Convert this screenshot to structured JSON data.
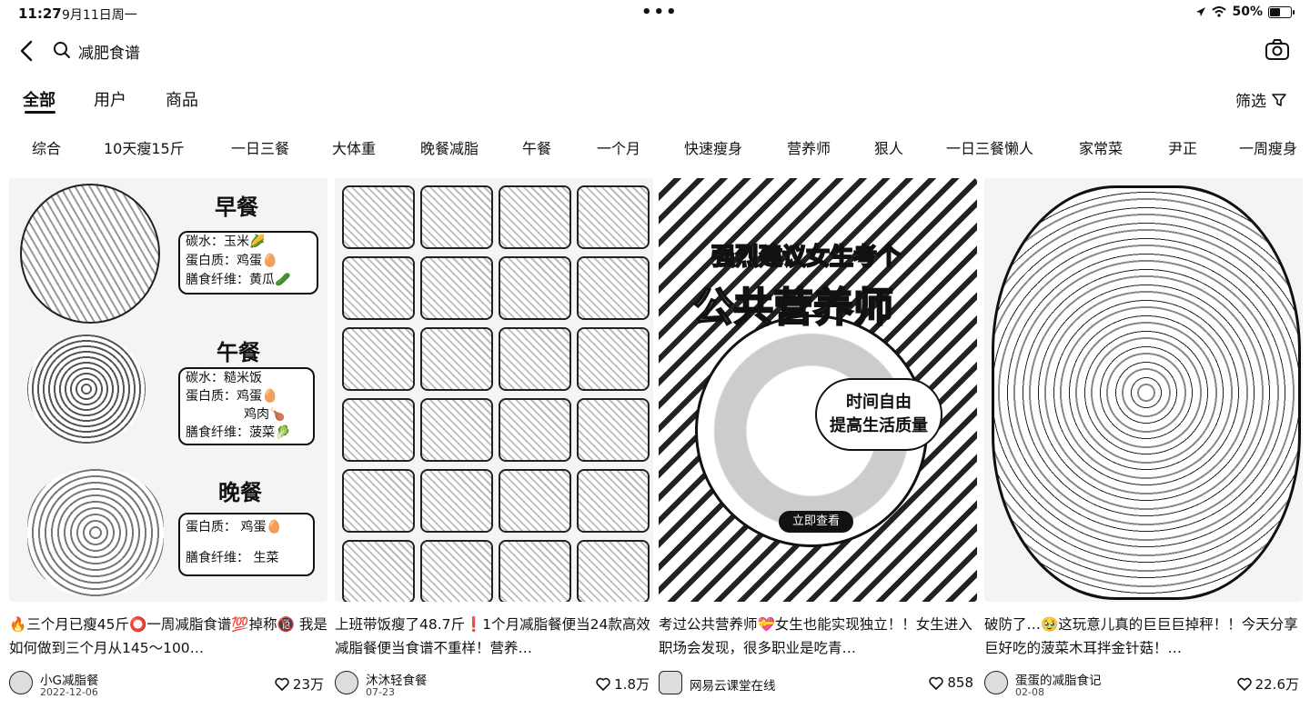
{
  "status": {
    "time": "11:27",
    "date": "9月11日周一",
    "battery": "50%"
  },
  "search": {
    "query": "减肥食谱"
  },
  "tabs": [
    {
      "label": "全部",
      "active": true
    },
    {
      "label": "用户",
      "active": false
    },
    {
      "label": "商品",
      "active": false
    }
  ],
  "filter": {
    "label": "筛选"
  },
  "chips": [
    "综合",
    "10天瘦15斤",
    "一日三餐",
    "大体重",
    "晚餐减脂",
    "午餐",
    "一个月",
    "快速瘦身",
    "营养师",
    "狠人",
    "一日三餐懒人",
    "家常菜",
    "尹正",
    "一周瘦身"
  ],
  "cards": [
    {
      "title": "🔥三个月已瘦45斤⭕一周减脂食谱💯掉称🔞 我是如何做到三个月从145～100…",
      "author": "小G减脂餐",
      "date": "2022-12-06",
      "likes": "23万",
      "image_text": {
        "breakfast": "早餐",
        "b1": "碳水：玉米🌽",
        "b2": "蛋白质：鸡蛋🥚",
        "b3": "膳食纤维：黄瓜🥒",
        "lunch": "午餐",
        "l1": "碳水：糙米饭",
        "l2": "蛋白质：鸡蛋🥚",
        "l3": "鸡肉🍗",
        "l4": "膳食纤维：菠菜🥬",
        "dinner": "晚餐",
        "d1": "蛋白质： 鸡蛋🥚",
        "d2": "膳食纤维： 生菜"
      }
    },
    {
      "title": "上班带饭瘦了48.7斤❗1个月减脂餐便当24款高效减脂餐便当食谱不重样！营养…",
      "author": "沐沐轻食餐",
      "date": "07-23",
      "likes": "1.8万"
    },
    {
      "title": "考过公共营养师💝女生也能实现独立！！女生进入职场会发现，很多职业是吃青…",
      "author": "网易云课堂在线",
      "date": "",
      "likes": "858",
      "image_text": {
        "line1": "强烈建议女生考个",
        "line2": "公共营养师",
        "badge1": "时间自由",
        "badge2": "提高生活质量",
        "cta": "立即查看"
      }
    },
    {
      "title": "破防了…🥹这玩意儿真的巨巨巨掉秤！！今天分享巨好吃的菠菜木耳拌金针菇！…",
      "author": "蛋蛋的减脂食记",
      "date": "02-08",
      "likes": "22.6万"
    }
  ]
}
